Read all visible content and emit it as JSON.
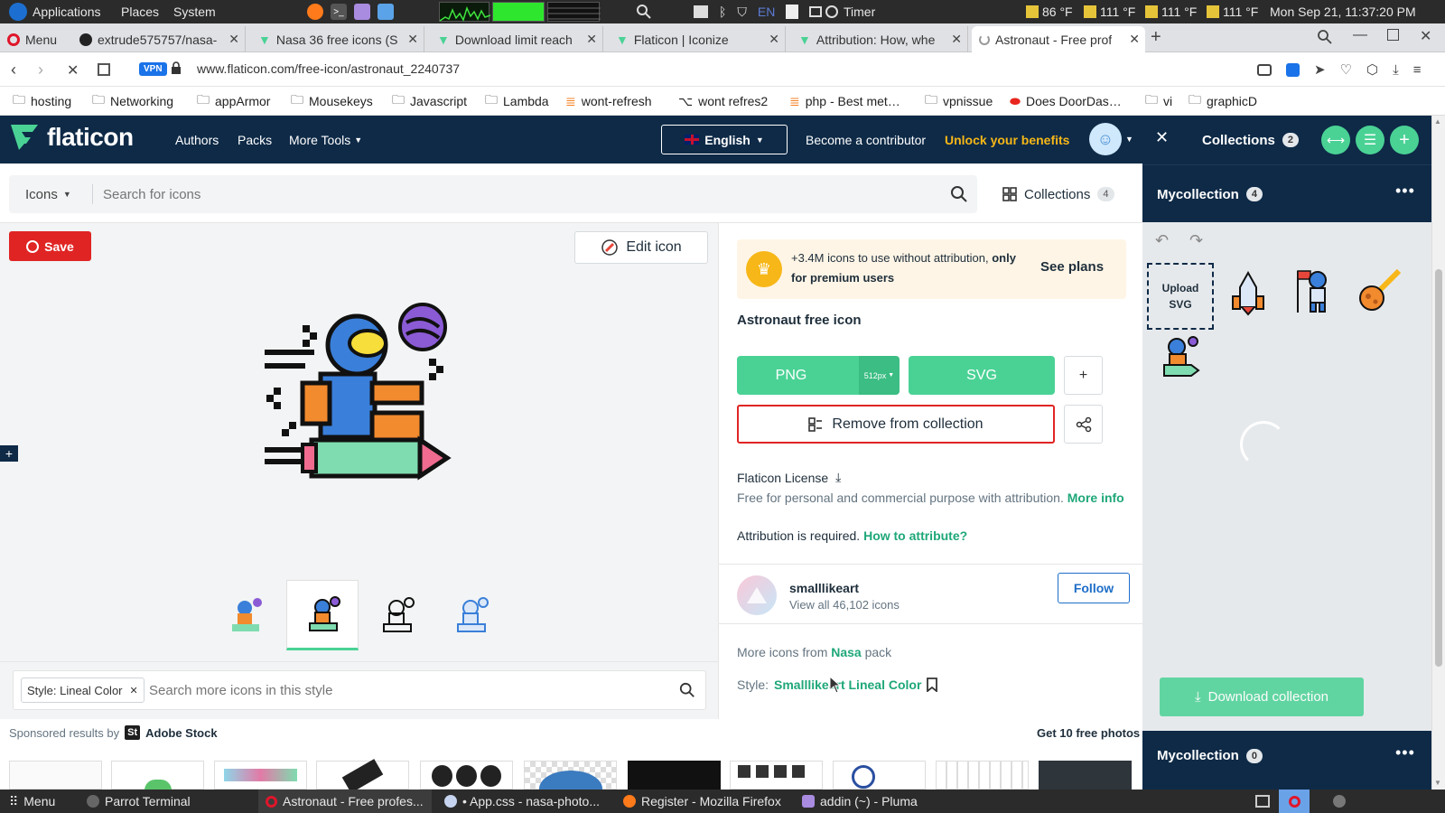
{
  "os_top": {
    "applications": "Applications",
    "places": "Places",
    "system": "System",
    "lang": "EN",
    "timer": "Timer",
    "temps": [
      "86 °F",
      "111 °F",
      "111 °F",
      "111 °F"
    ],
    "clock": "Mon Sep 21, 11:37:20 PM"
  },
  "tabs": [
    {
      "label": "Menu",
      "icon": "opera-icon"
    },
    {
      "label": "extrude575757/nasa-",
      "icon": "github-icon"
    },
    {
      "label": "Nasa 36 free icons (S",
      "icon": "flaticon-icon"
    },
    {
      "label": "Download limit reach",
      "icon": "flaticon-icon"
    },
    {
      "label": "Flaticon | Iconize",
      "icon": "flaticon-icon"
    },
    {
      "label": "Attribution: How, whe",
      "icon": "flaticon-icon"
    },
    {
      "label": "Astronaut - Free prof",
      "icon": "loading-icon"
    }
  ],
  "nav": {
    "url": "www.flaticon.com/free-icon/astronaut_2240737",
    "vpn": "VPN"
  },
  "bookmarks": [
    "hosting",
    "Networking",
    "appArmor",
    "Mousekeys",
    "Javascript",
    "Lambda",
    "wont-refresh",
    "wont refres2",
    "php - Best met…",
    "vpnissue",
    "Does DoorDas…",
    "vi",
    "graphicD"
  ],
  "site_header": {
    "logo": "flaticon",
    "nav_items": [
      "Authors",
      "Packs",
      "More Tools"
    ],
    "language": "English",
    "contributor": "Become a contributor",
    "unlock": "Unlock your benefits"
  },
  "search": {
    "type_label": "Icons",
    "placeholder": "Search for icons",
    "collections_label": "Collections",
    "collections_count": "4"
  },
  "left": {
    "save_label": "Save",
    "edit_label": "Edit icon",
    "style_tag": "Style: Lineal Color",
    "style_placeholder": "Search more icons in this style"
  },
  "detail": {
    "premium_text": "+3.4M icons to use without attribution,",
    "premium_bold": "only for premium users",
    "see_plans": "See plans",
    "title": "Astronaut free icon",
    "png": "PNG",
    "png_size": "512px",
    "svg": "SVG",
    "plus": "+",
    "remove": "Remove from collection",
    "license_title": "Flaticon License",
    "license_text": "Free for personal and commercial purpose with attribution.",
    "more_info": "More info",
    "attribution": "Attribution is required.",
    "how_to": "How to attribute?",
    "author_name": "smalllikeart",
    "author_count": "View all 46,102 icons",
    "follow": "Follow",
    "more_from_prefix": "More icons from",
    "pack_name": "Nasa",
    "more_from_suffix": "pack",
    "style_prefix": "Style:",
    "style_name": "Smalllikeart Lineal Color"
  },
  "sponsored": {
    "label": "Sponsored results by",
    "brand": "Adobe Stock",
    "badge": "St",
    "free": "Get 10 free photos"
  },
  "collections_panel": {
    "title": "Collections",
    "count": "2",
    "collection1": "Mycollection",
    "collection1_count": "4",
    "upload": "Upload SVG",
    "download": "Download collection",
    "collection2": "Mycollection",
    "collection2_count": "0"
  },
  "taskbar": {
    "menu": "Menu",
    "items": [
      "Parrot Terminal",
      "Astronaut - Free profes...",
      "• App.css - nasa-photo...",
      "Register - Mozilla Firefox",
      "addin (~) - Pluma"
    ]
  },
  "colors": {
    "brand_green": "#4ad295",
    "header_navy": "#0e2a47",
    "save_red": "#e02424",
    "premium_bg": "#fff5e6",
    "gold": "#f7b718",
    "remove_border": "#e02424",
    "link_green": "#1fa77a",
    "follow_blue": "#1e6ec8"
  }
}
